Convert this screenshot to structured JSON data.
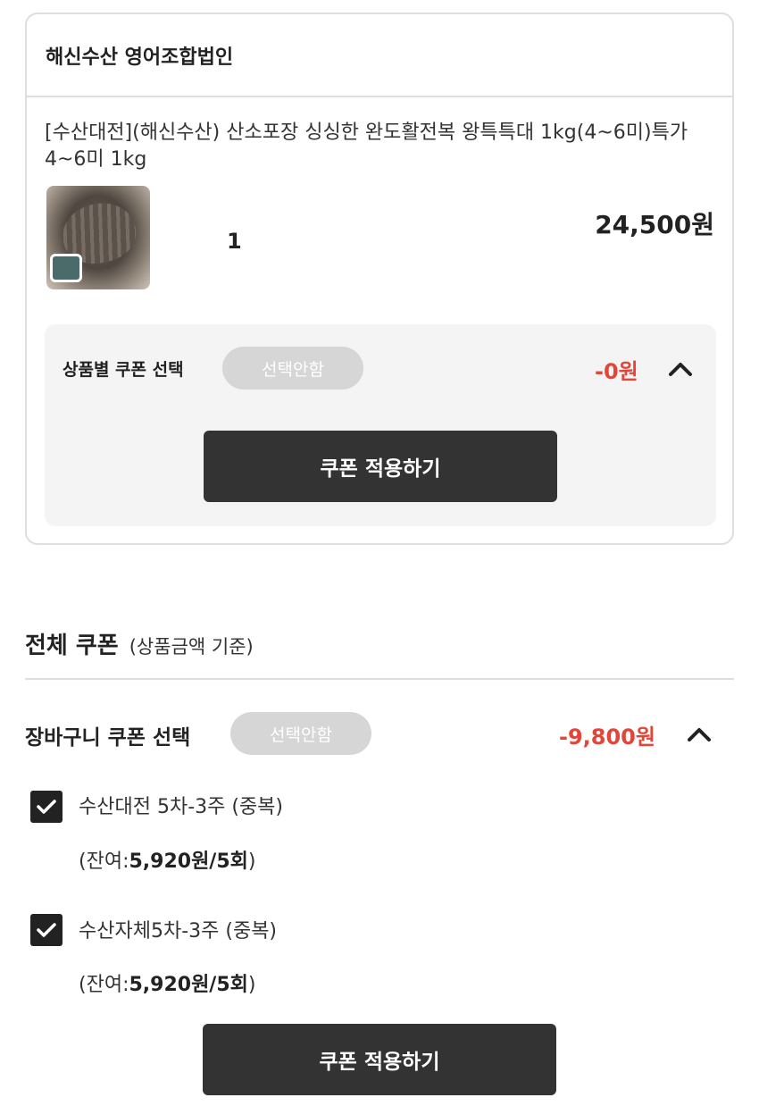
{
  "seller": {
    "name": "해신수산 영어조합법인"
  },
  "product": {
    "title": "[수산대전](해신수산) 산소포장 싱싱한 완도활전복 왕특특대 1kg(4~6미)특가 4~6미 1kg",
    "quantity": "1",
    "price": "24,500원",
    "image": "abalone-product-photo"
  },
  "product_coupon": {
    "label": "상품별 쿠폰 선택",
    "select_value": "선택안함",
    "discount": "-0원",
    "apply_label": "쿠폰 적용하기"
  },
  "cart_coupon_section": {
    "title": "전체 쿠폰",
    "subtitle": "(상품금액 기준)"
  },
  "cart_coupon": {
    "label": "장바구니 쿠폰 선택",
    "select_value": "선택안함",
    "discount": "-9,800원",
    "coupons": [
      {
        "name": "수산대전 5차-3주 (중복)",
        "checked": true,
        "remain_prefix": "(잔여:",
        "remain_value": "5,920원/5회",
        "remain_suffix": ")"
      },
      {
        "name": "수산자체5차-3주 (중복)",
        "checked": true,
        "remain_prefix": "(잔여:",
        "remain_value": "5,920원/5회",
        "remain_suffix": ")"
      }
    ],
    "apply_label": "쿠폰 적용하기"
  },
  "colors": {
    "discount_red": "#e0463a",
    "button_dark": "#333333",
    "pill_gray": "#d6d6d6",
    "panel_bg": "#f4f4f4",
    "border": "#dedede"
  },
  "icons": [
    "chevron-up-icon",
    "checkmark-icon"
  ]
}
